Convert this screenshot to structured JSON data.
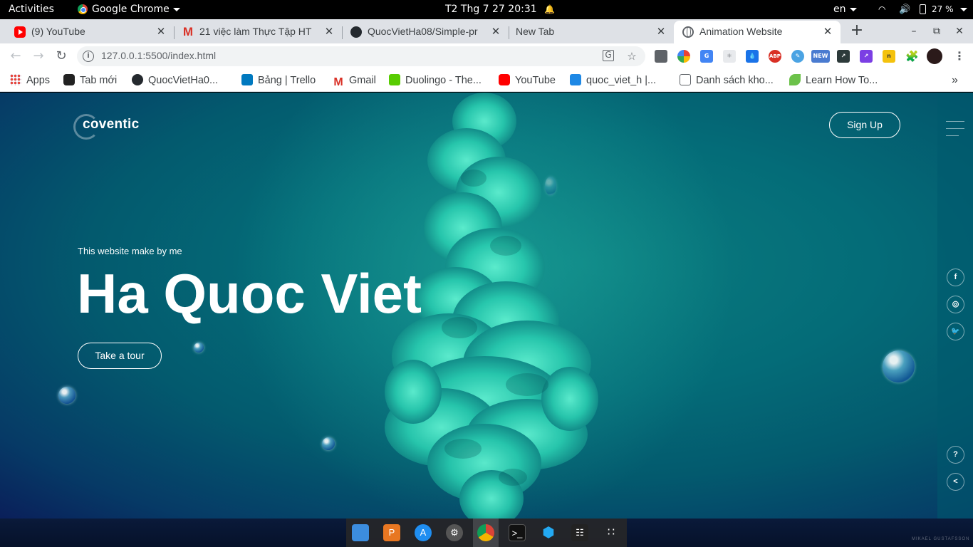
{
  "topbar": {
    "activities": "Activities",
    "app_menu": "Google Chrome",
    "clock": "T2 Thg 7 27  20:31",
    "keyboard_lang": "en",
    "battery": "27 %"
  },
  "tabs": [
    {
      "title": "(9) YouTube",
      "icon": "youtube-icon"
    },
    {
      "title": "21 việc làm Thực Tập HT",
      "icon": "gmail-icon"
    },
    {
      "title": "QuocVietHa08/Simple-pr",
      "icon": "github-icon"
    },
    {
      "title": "New Tab",
      "icon": ""
    },
    {
      "title": "Animation Website",
      "icon": "globe-icon",
      "active": true
    }
  ],
  "omnibox": {
    "url": "127.0.0.1:5500/index.html"
  },
  "bookmarks": [
    {
      "label": "Apps"
    },
    {
      "label": "Tab mới"
    },
    {
      "label": "QuocVietHa0..."
    },
    {
      "label": "Bảng | Trello"
    },
    {
      "label": "Gmail"
    },
    {
      "label": "Duolingo - The..."
    },
    {
      "label": "YouTube"
    },
    {
      "label": "quoc_viet_h |..."
    },
    {
      "label": "Danh sách kho..."
    },
    {
      "label": "Learn How To..."
    }
  ],
  "page": {
    "logo": "coventic",
    "signup": "Sign Up",
    "subtitle": "This website make by me",
    "hero_title": "Ha Quoc Viet",
    "tour_button": "Take a tour",
    "social": [
      "f",
      "◎",
      "🐦"
    ],
    "help": "?",
    "share": "<"
  },
  "dock": {
    "credit": "MIKAEL GUSTAFSSON"
  },
  "colors": {
    "page_teal": "#046c78",
    "smoke": "#2fd3b8"
  }
}
